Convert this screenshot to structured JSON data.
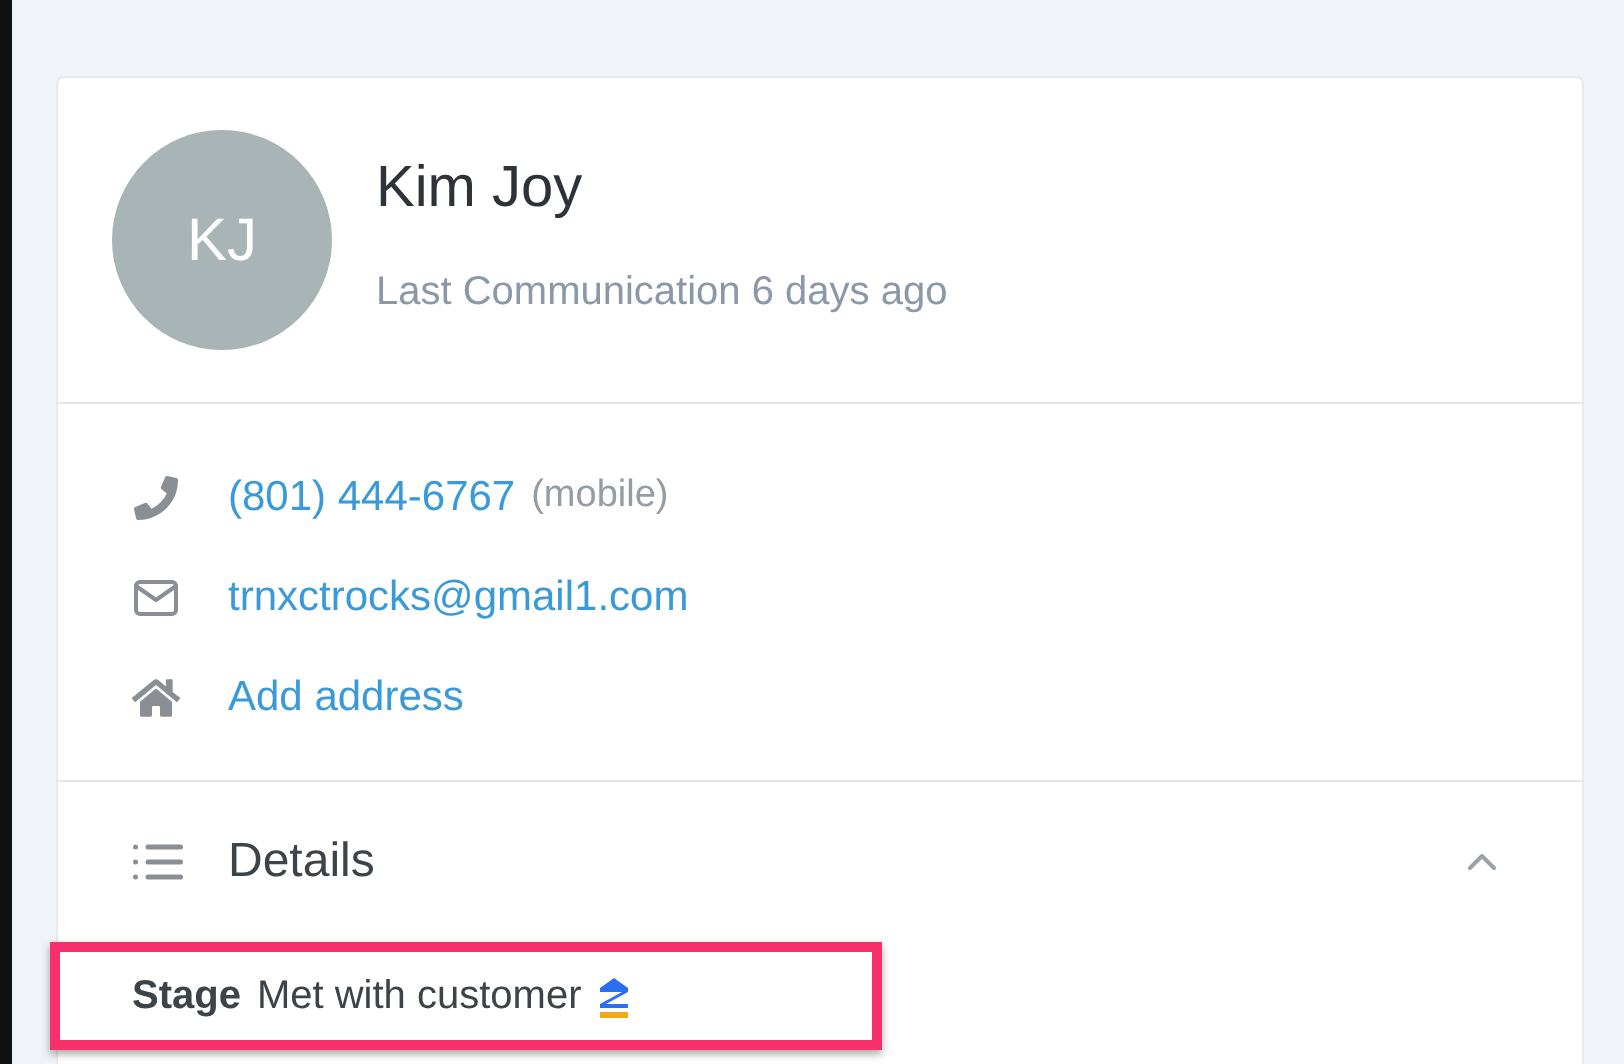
{
  "contact": {
    "initials": "KJ",
    "name": "Kim Joy",
    "last_communication": "Last Communication 6 days ago"
  },
  "info": [
    {
      "kind": "phone",
      "value": "(801) 444-6767",
      "note": "(mobile)"
    },
    {
      "kind": "email",
      "value": "trnxctrocks@gmail1.com"
    },
    {
      "kind": "address",
      "value": "Add address"
    }
  ],
  "details": {
    "title": "Details",
    "expanded": true,
    "fields": [
      {
        "label": "Stage",
        "value": "Met with customer",
        "highlighted": true
      }
    ]
  }
}
